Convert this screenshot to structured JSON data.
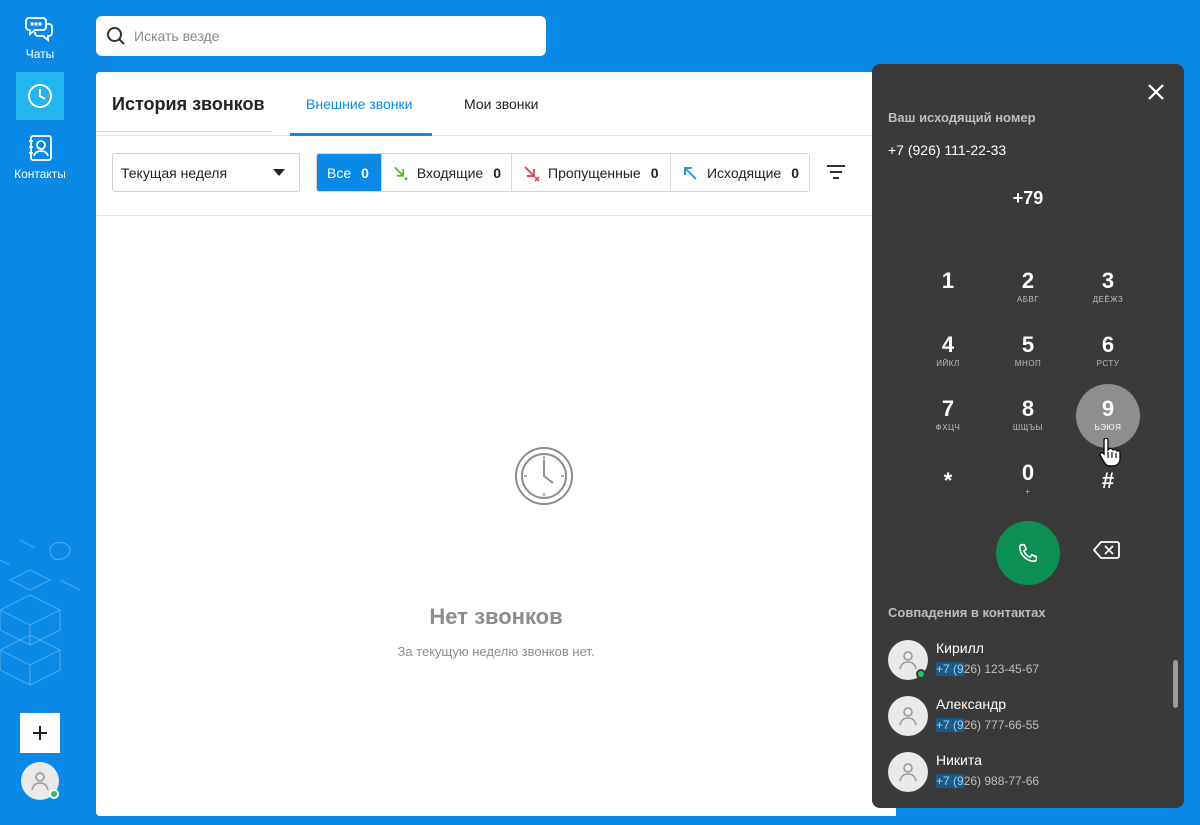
{
  "sidebar": {
    "items": [
      {
        "label": "Чаты",
        "icon": "chats-icon"
      },
      {
        "label": "",
        "icon": "clock-icon",
        "active": true
      },
      {
        "label": "Контакты",
        "icon": "contacts-icon"
      }
    ],
    "add_label": "+"
  },
  "search": {
    "placeholder": "Искать везде",
    "value": ""
  },
  "main": {
    "title": "История звонков",
    "tabs": [
      {
        "label": "Внешние звонки",
        "active": true
      },
      {
        "label": "Мои звонки",
        "active": false
      }
    ],
    "period": {
      "selected": "Текущая неделя"
    },
    "call_filters": [
      {
        "label": "Все",
        "count": "0",
        "active": true
      },
      {
        "label": "Входящие",
        "count": "0",
        "icon": "incoming-arrow-icon",
        "color": "#5ab82b"
      },
      {
        "label": "Пропущенные",
        "count": "0",
        "icon": "missed-arrow-icon",
        "color": "#e8445a"
      },
      {
        "label": "Исходящие",
        "count": "0",
        "icon": "outgoing-arrow-icon",
        "color": "#2a9ad8"
      }
    ],
    "empty": {
      "title": "Нет звонков",
      "subtitle": "За текущую неделю звонков нет."
    }
  },
  "dialer": {
    "outgoing_label": "Ваш исходящий номер",
    "outgoing_number": "+7 (926) 111-22-33",
    "entered": "+79",
    "keys": [
      {
        "digit": "1",
        "letters": ""
      },
      {
        "digit": "2",
        "letters": "АБВГ"
      },
      {
        "digit": "3",
        "letters": "ДЕЁЖЗ"
      },
      {
        "digit": "4",
        "letters": "ИЙКЛ"
      },
      {
        "digit": "5",
        "letters": "МНОП"
      },
      {
        "digit": "6",
        "letters": "РСТУ"
      },
      {
        "digit": "7",
        "letters": "ФХЦЧ"
      },
      {
        "digit": "8",
        "letters": "ШЩЪЫ"
      },
      {
        "digit": "9",
        "letters": "ЬЭЮЯ",
        "pressed": true
      },
      {
        "digit": "*",
        "letters": ""
      },
      {
        "digit": "0",
        "letters": "+"
      },
      {
        "digit": "#",
        "letters": ""
      }
    ],
    "matches_label": "Совпадения в контактах",
    "contacts": [
      {
        "name": "Кирилл",
        "phone_match": "+7 (9",
        "phone_rest": "26) 123-45-67",
        "online": true
      },
      {
        "name": "Александр",
        "phone_match": "+7 (9",
        "phone_rest": "26) 777-66-55",
        "online": false
      },
      {
        "name": "Никита",
        "phone_match": "+7 (9",
        "phone_rest": "26) 988-77-66",
        "online": false
      }
    ]
  },
  "colors": {
    "accent": "#0a8ae6",
    "dialer_bg": "#3a3a3a",
    "call_green": "#0b8f53"
  }
}
